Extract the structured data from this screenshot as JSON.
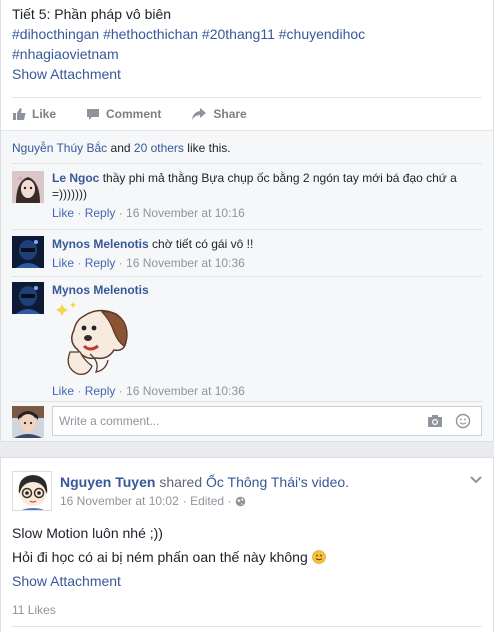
{
  "post1": {
    "title_line": "Tiết 5: Phần pháp vô biên",
    "hashtags_line1": "#dihocthingan #hethocthichan #20thang11 #chuyendihoc",
    "hashtags_line2": "#nhagiaovietnam",
    "show_attachment": "Show Attachment",
    "actions": {
      "like": "Like",
      "comment": "Comment",
      "share": "Share"
    },
    "likes": {
      "name": "Nguyễn Thúy Bắc",
      "and": "and",
      "others": "20 others",
      "suffix": "like this."
    },
    "comments": [
      {
        "author": "Le Ngoc",
        "text": "thầy phi mả thằng Bựa chụp ốc bằng 2 ngón tay mới bá đạo chứ a =)))))))",
        "like": "Like",
        "reply": "Reply",
        "time": "16 November at 10:16"
      },
      {
        "author": "Mynos Melenotis",
        "text": "chờ tiết có gái vô !!",
        "like": "Like",
        "reply": "Reply",
        "time": "16 November at 10:36"
      },
      {
        "author": "Mynos Melenotis",
        "text": "",
        "like": "Like",
        "reply": "Reply",
        "time": "16 November at 10:36"
      }
    ],
    "write_comment_placeholder": "Write a comment..."
  },
  "post2": {
    "author": "Nguyen Tuyen",
    "shared_text": "shared",
    "page_name": "Ốc Thông Thái",
    "video_text": "'s video.",
    "timestamp": "16 November at 10:02",
    "edited": "· Edited ·",
    "line1": "Slow Motion luôn nhé ;))",
    "line2": "Hỏi đi học có ai bị ném phấn oan thế này không",
    "show_attachment": "Show Attachment",
    "likes_count": "11 Likes"
  },
  "colors": {
    "link": "#365899",
    "muted": "#90949c",
    "background": "#e9ebee"
  }
}
